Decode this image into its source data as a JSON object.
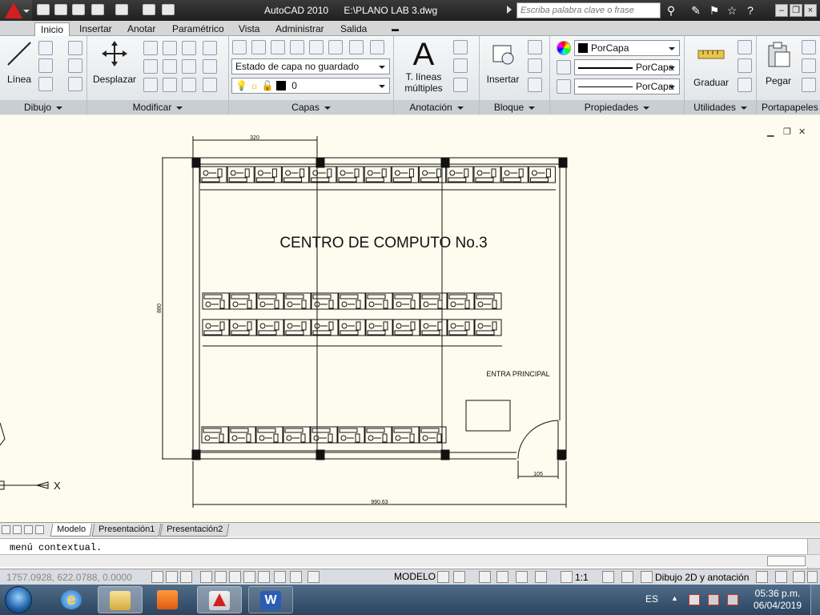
{
  "titlebar": {
    "app_name": "AutoCAD 2010",
    "file_path": "E:\\PLANO LAB 3.dwg",
    "search_placeholder": "Escriba palabra clave o frase"
  },
  "ribbon_tabs": [
    {
      "label": "Inicio",
      "active": true
    },
    {
      "label": "Insertar"
    },
    {
      "label": "Anotar"
    },
    {
      "label": "Paramétrico"
    },
    {
      "label": "Vista"
    },
    {
      "label": "Administrar"
    },
    {
      "label": "Salida"
    }
  ],
  "panels": {
    "dibujo": {
      "title": "Dibujo",
      "linea_label": "Línea"
    },
    "modificar": {
      "title": "Modificar",
      "desplazar_label": "Desplazar"
    },
    "capas": {
      "title": "Capas",
      "layer_state": "Estado de capa no guardado",
      "current_layer": "0"
    },
    "anotacion": {
      "title": "Anotación",
      "mtext_label_1": "T. líneas",
      "mtext_label_2": "múltiples",
      "glyph": "A"
    },
    "bloque": {
      "title": "Bloque",
      "insert_label": "Insertar"
    },
    "propiedades": {
      "title": "Propiedades",
      "color": "PorCapa",
      "linetype": "PorCapa",
      "lineweight": "PorCapa"
    },
    "utilidades": {
      "title": "Utilidades",
      "measure_label": "Graduar"
    },
    "portapapeles": {
      "title": "Portapapeles",
      "paste_label": "Pegar"
    }
  },
  "drawing": {
    "title": "CENTRO DE COMPUTO No.3",
    "entrance_label": "ENTRA PRINCIPAL",
    "dim_top": "320",
    "dim_bottom": "990.63",
    "dim_door": "105",
    "dim_left": "880",
    "axis_x_label": "X"
  },
  "layout_tabs": [
    {
      "label": "Modelo",
      "active": true
    },
    {
      "label": "Presentación1"
    },
    {
      "label": "Presentación2"
    }
  ],
  "command_line": {
    "text": "menú contextual."
  },
  "statusbar": {
    "coordinates": "1757.0928, 622.0788, 0.0000",
    "model_label": "MODELO",
    "scale": "1:1",
    "workspace": "Dibujo 2D y anotación"
  },
  "taskbar": {
    "language": "ES",
    "time": "05:36 p.m.",
    "date": "06/04/2019"
  },
  "colors": {
    "canvas_bg": "#fdfcee",
    "title_bg": "#2a2a2a",
    "autocad_red": "#d21f1f",
    "taskbar_bg": "#3b5673"
  }
}
